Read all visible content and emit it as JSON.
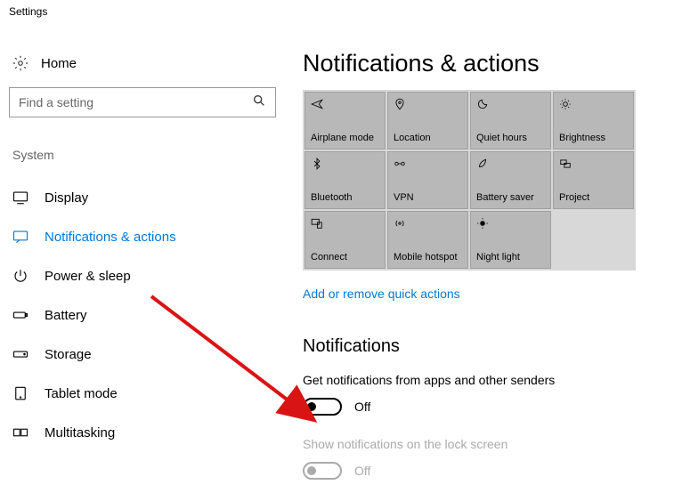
{
  "window_title": "Settings",
  "sidebar": {
    "home_label": "Home",
    "search_placeholder": "Find a setting",
    "category_label": "System",
    "items": [
      {
        "label": "Display"
      },
      {
        "label": "Notifications & actions"
      },
      {
        "label": "Power & sleep"
      },
      {
        "label": "Battery"
      },
      {
        "label": "Storage"
      },
      {
        "label": "Tablet mode"
      },
      {
        "label": "Multitasking"
      }
    ]
  },
  "content": {
    "page_title": "Notifications & actions",
    "quick_actions": [
      {
        "label": "Airplane mode"
      },
      {
        "label": "Location"
      },
      {
        "label": "Quiet hours"
      },
      {
        "label": "Brightness"
      },
      {
        "label": "Bluetooth"
      },
      {
        "label": "VPN"
      },
      {
        "label": "Battery saver"
      },
      {
        "label": "Project"
      },
      {
        "label": "Connect"
      },
      {
        "label": "Mobile hotspot"
      },
      {
        "label": "Night light"
      }
    ],
    "quick_actions_link": "Add or remove quick actions",
    "notifications_section_title": "Notifications",
    "settings": [
      {
        "label": "Get notifications from apps and other senders",
        "state_text": "Off",
        "disabled": false
      },
      {
        "label": "Show notifications on the lock screen",
        "state_text": "Off",
        "disabled": true
      }
    ]
  }
}
